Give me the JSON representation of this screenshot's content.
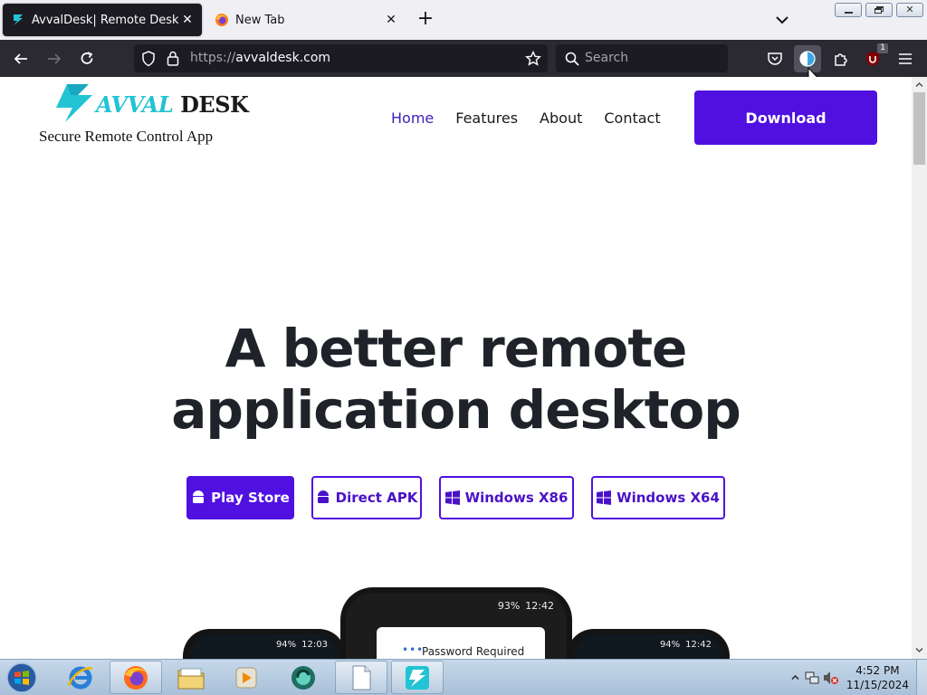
{
  "browser": {
    "tabs": [
      {
        "label": "AvvalDesk| Remote Desktop",
        "active": true
      },
      {
        "label": "New Tab",
        "active": false
      }
    ],
    "url_scheme": "https://",
    "url_host": "avvaldesk.com",
    "search_placeholder": "Search",
    "extension_badge": "1"
  },
  "site": {
    "brand_part1": "AVVAL",
    "brand_part2": "DESK",
    "tagline": "Secure Remote Control App",
    "nav": [
      {
        "label": "Home",
        "current": true
      },
      {
        "label": "Features",
        "current": false
      },
      {
        "label": "About",
        "current": false
      },
      {
        "label": "Contact",
        "current": false
      }
    ],
    "download_label": "Download",
    "hero_line1": "A better remote",
    "hero_line2": "application desktop",
    "download_options": [
      {
        "label": "Play Store",
        "icon": "android-icon"
      },
      {
        "label": "Direct APK",
        "icon": "android-icon"
      },
      {
        "label": "Windows X86",
        "icon": "windows-icon"
      },
      {
        "label": "Windows X64",
        "icon": "windows-icon"
      }
    ],
    "phone_center": {
      "battery": "93%",
      "time": "12:42",
      "dialog_title": "Password Required"
    },
    "phone_left": {
      "battery": "94%",
      "time": "12:03"
    },
    "phone_right": {
      "battery": "94%",
      "time": "12:42"
    }
  },
  "taskbar": {
    "time": "4:52 PM",
    "date": "11/15/2024"
  },
  "colors": {
    "accent": "#5010e0",
    "brand_cyan": "#22c3d3",
    "browser_dark": "#2b2a33"
  }
}
